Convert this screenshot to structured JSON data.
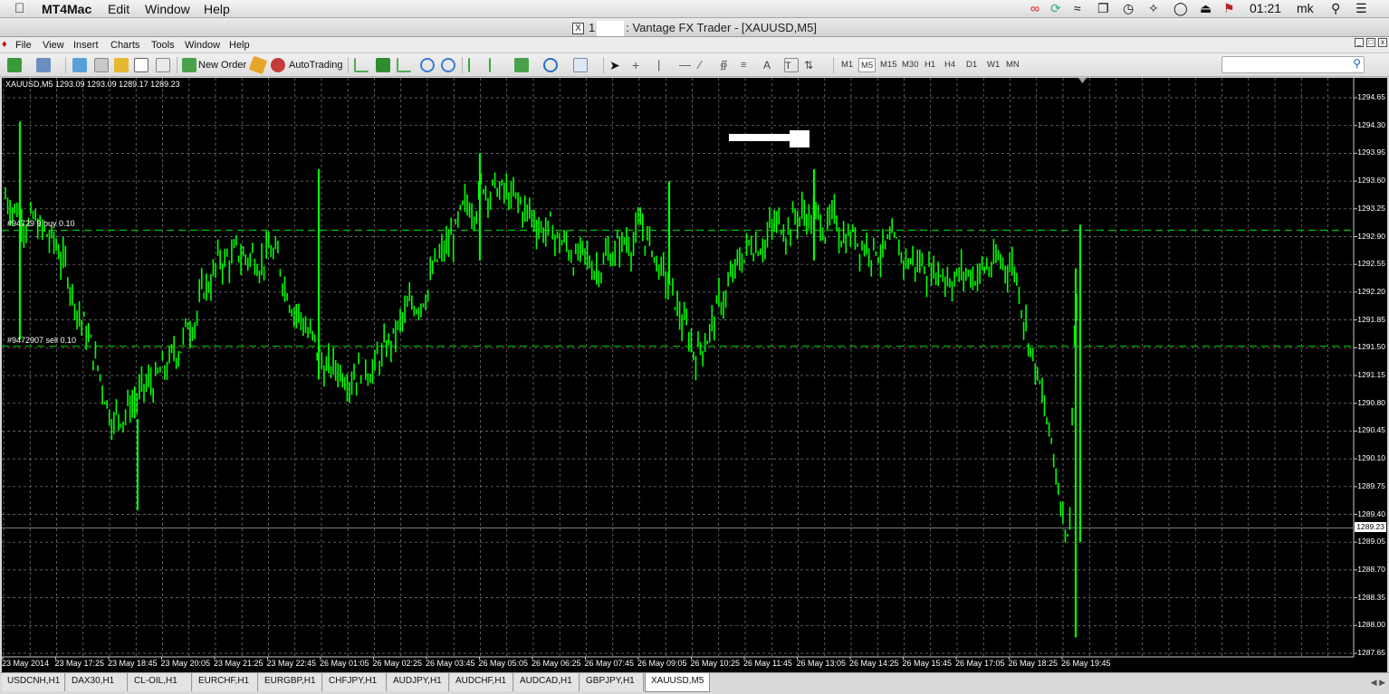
{
  "mac_menu": {
    "app": "MT4Mac",
    "items": [
      "Edit",
      "Window",
      "Help"
    ],
    "clock": "01:21",
    "user": "mk"
  },
  "window": {
    "title_prefix": "1",
    "title": ": Vantage FX Trader - [XAUUSD,M5]"
  },
  "app_menu": [
    "File",
    "View",
    "Insert",
    "Charts",
    "Tools",
    "Window",
    "Help"
  ],
  "toolbar": {
    "new_order": "New Order",
    "autotrading": "AutoTrading",
    "timeframes": [
      "M1",
      "M5",
      "M15",
      "M30",
      "H1",
      "H4",
      "D1",
      "W1",
      "MN"
    ],
    "active_timeframe": "M5",
    "search_placeholder": ""
  },
  "chart": {
    "header": "XAUUSD,M5  1293.09 1293.09 1289.17 1289.23",
    "current_price": "1289.23",
    "orders": [
      {
        "label": "#94729 9 buy 0.10",
        "price": 1292.98
      },
      {
        "label": "#9472907 sell 0.10",
        "price": 1291.52
      }
    ],
    "price_ticks": [
      "1294.65",
      "1294.30",
      "1293.95",
      "1293.60",
      "1293.25",
      "1292.90",
      "1292.55",
      "1292.20",
      "1291.85",
      "1291.50",
      "1291.15",
      "1290.80",
      "1290.45",
      "1290.10",
      "1289.75",
      "1289.40",
      "1289.05",
      "1288.70",
      "1288.35",
      "1288.00",
      "1287.65"
    ],
    "time_ticks": [
      "23 May 2014",
      "23 May 17:25",
      "23 May 18:45",
      "23 May 20:05",
      "23 May 21:25",
      "23 May 22:45",
      "26 May 01:05",
      "26 May 02:25",
      "26 May 03:45",
      "26 May 05:05",
      "26 May 06:25",
      "26 May 07:45",
      "26 May 09:05",
      "26 May 10:25",
      "26 May 11:45",
      "26 May 13:05",
      "26 May 14:25",
      "26 May 15:45",
      "26 May 17:05",
      "26 May 18:25",
      "26 May 19:45"
    ],
    "colors": {
      "background": "#000000",
      "bars": "#00ff00",
      "grid": "#808080",
      "order_line": "#00c000"
    }
  },
  "chart_data": {
    "type": "line",
    "title": "XAUUSD,M5",
    "ylim": [
      1287.65,
      1294.65
    ],
    "x": [
      "23 May 2014",
      "23 May 17:25",
      "23 May 18:45",
      "23 May 20:05",
      "23 May 21:25",
      "23 May 22:45",
      "26 May 01:05",
      "26 May 02:25",
      "26 May 03:45",
      "26 May 05:05",
      "26 May 06:25",
      "26 May 07:45",
      "26 May 09:05",
      "26 May 10:25",
      "26 May 11:45",
      "26 May 13:05",
      "26 May 14:25",
      "26 May 15:45",
      "26 May 17:05",
      "26 May 18:25",
      "26 May 19:45"
    ],
    "series": [
      {
        "values": [
          1293.4,
          1292.7,
          1290.6,
          1291.2,
          1292.6,
          1292.7,
          1291.2,
          1291.3,
          1292.4,
          1293.6,
          1293.1,
          1292.5,
          1293.0,
          1291.4,
          1292.8,
          1293.2,
          1292.9,
          1292.6,
          1292.4,
          1292.6,
          1289.23
        ]
      }
    ]
  },
  "tabs": [
    "USDCNH,H1",
    "DAX30,H1",
    "CL-OIL,H1",
    "EURCHF,H1",
    "EURGBP,H1",
    "CHFJPY,H1",
    "AUDJPY,H1",
    "AUDCHF,H1",
    "AUDCAD,H1",
    "GBPJPY,H1",
    "XAUUSD,M5"
  ],
  "active_tab": "XAUUSD,M5"
}
